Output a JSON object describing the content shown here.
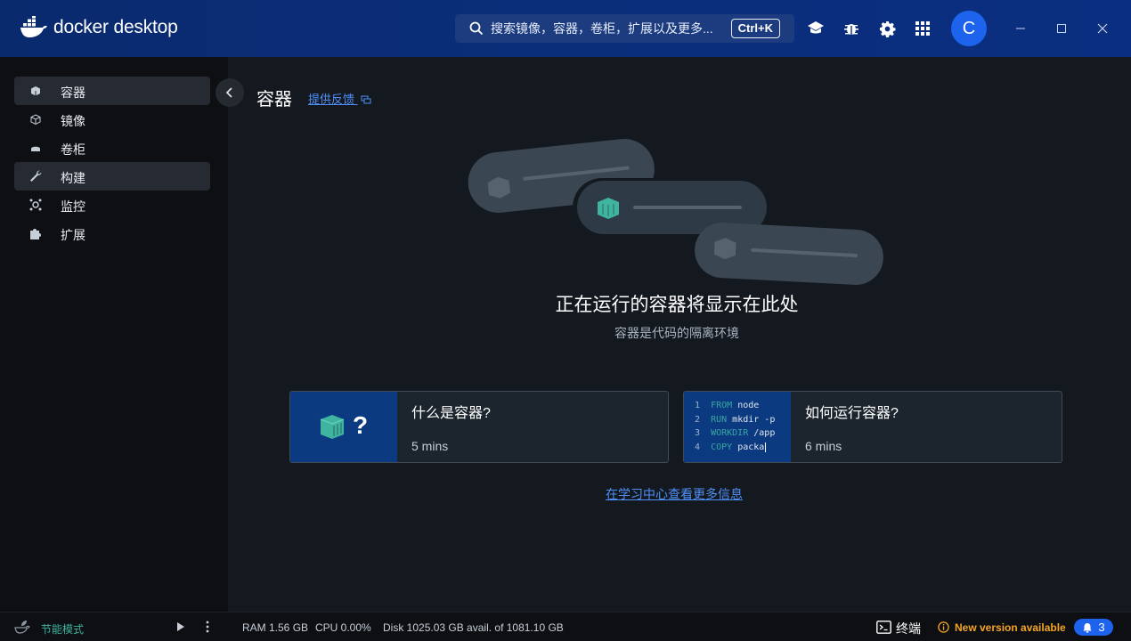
{
  "app": {
    "name": "docker desktop"
  },
  "search": {
    "placeholder": "搜索镜像，容器，卷柜，扩展以及更多...",
    "shortcut": "Ctrl+K"
  },
  "user": {
    "initial": "C"
  },
  "sidebar": {
    "items": [
      {
        "label": "容器",
        "icon": "container-icon",
        "active": true
      },
      {
        "label": "镜像",
        "icon": "image-icon",
        "active": false
      },
      {
        "label": "卷柜",
        "icon": "volume-icon",
        "active": false
      },
      {
        "label": "构建",
        "icon": "wrench-icon",
        "active": false
      },
      {
        "label": "监控",
        "icon": "monitor-icon",
        "active": false
      },
      {
        "label": "扩展",
        "icon": "puzzle-icon",
        "active": false
      }
    ]
  },
  "page": {
    "title": "容器",
    "feedback": "提供反馈",
    "empty_heading": "正在运行的容器将显示在此处",
    "empty_sub": "容器是代码的隔离环境",
    "learn_more": "在学习中心查看更多信息"
  },
  "cards": [
    {
      "title": "什么是容器?",
      "duration": "5 mins",
      "thumb_mark": "?"
    },
    {
      "title": "如何运行容器?",
      "duration": "6 mins",
      "code": [
        {
          "n": "1",
          "kw": "FROM",
          "rest": "node"
        },
        {
          "n": "2",
          "kw": "RUN",
          "rest": "mkdir -p"
        },
        {
          "n": "3",
          "kw": "WORKDIR",
          "rest": "/app"
        },
        {
          "n": "4",
          "kw": "COPY",
          "rest": "packa"
        }
      ]
    }
  ],
  "footer": {
    "eco_mode": "节能模式",
    "ram": "RAM 1.56 GB",
    "cpu": "CPU 0.00%",
    "disk": "Disk 1025.03 GB avail. of 1081.10 GB",
    "terminal": "终端",
    "update": "New version available",
    "notifications": "3"
  },
  "colors": {
    "accent": "#1d63ed",
    "topbar": "#0a2a6e",
    "teal": "#3fb5a0",
    "update": "#f5a524"
  }
}
